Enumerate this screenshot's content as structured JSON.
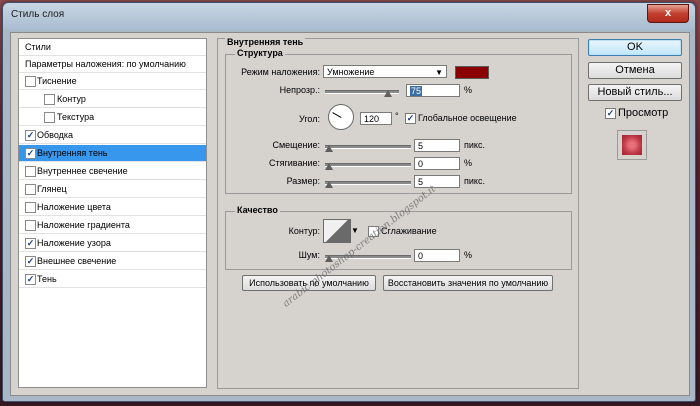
{
  "window": {
    "title": "Стиль слоя",
    "close_glyph": "x"
  },
  "styles_list": {
    "header": "Стили",
    "blending": "Параметры наложения: по умолчанию",
    "items": [
      {
        "label": "Тиснение",
        "checked": false,
        "indent": false
      },
      {
        "label": "Контур",
        "checked": false,
        "indent": true
      },
      {
        "label": "Текстура",
        "checked": false,
        "indent": true
      },
      {
        "label": "Обводка",
        "checked": true,
        "indent": false
      },
      {
        "label": "Внутренняя тень",
        "checked": true,
        "indent": false,
        "active": true
      },
      {
        "label": "Внутреннее свечение",
        "checked": false,
        "indent": false
      },
      {
        "label": "Глянец",
        "checked": false,
        "indent": false
      },
      {
        "label": "Наложение цвета",
        "checked": false,
        "indent": false
      },
      {
        "label": "Наложение градиента",
        "checked": false,
        "indent": false
      },
      {
        "label": "Наложение узора",
        "checked": true,
        "indent": false
      },
      {
        "label": "Внешнее свечение",
        "checked": true,
        "indent": false
      },
      {
        "label": "Тень",
        "checked": true,
        "indent": false
      }
    ]
  },
  "panel": {
    "title": "Внутренняя тень",
    "structure": {
      "title": "Структура",
      "blend_mode_label": "Режим наложения:",
      "blend_mode_value": "Умножение",
      "color": "#8b0000",
      "opacity_label": "Непрозр.:",
      "opacity_value": "75",
      "opacity_unit": "%",
      "angle_label": "Угол:",
      "angle_value": "120",
      "angle_unit": "°",
      "global_light_label": "Глобальное освещение",
      "global_light_checked": true,
      "distance_label": "Смещение:",
      "distance_value": "5",
      "distance_unit": "пикс.",
      "choke_label": "Стягивание:",
      "choke_value": "0",
      "choke_unit": "%",
      "size_label": "Размер:",
      "size_value": "5",
      "size_unit": "пикс."
    },
    "quality": {
      "title": "Качество",
      "contour_label": "Контур:",
      "antialias_label": "Сглаживание",
      "antialias_checked": false,
      "noise_label": "Шум:",
      "noise_value": "0",
      "noise_unit": "%"
    },
    "make_default": "Использовать по умолчанию",
    "reset_default": "Восстановить значения по умолчанию"
  },
  "buttons": {
    "ok": "OK",
    "cancel": "Отмена",
    "new_style": "Новый стиль...",
    "preview_label": "Просмотр",
    "preview_checked": true
  },
  "watermark": "arabic-photoshop-creation.blogspot.it"
}
